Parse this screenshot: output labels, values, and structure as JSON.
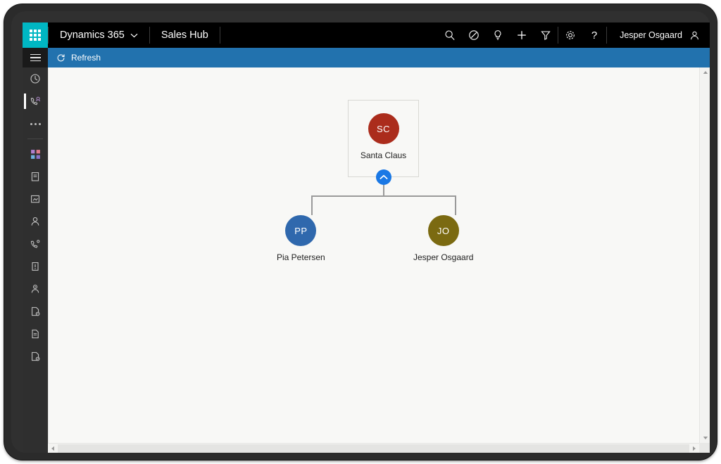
{
  "topbar": {
    "app_launcher_icon": "waffle-grid-icon",
    "brand": "Dynamics 365",
    "brand_chevron_icon": "chevron-down-icon",
    "app_name": "Sales Hub",
    "icons": [
      {
        "name": "search-icon",
        "glyph": "search"
      },
      {
        "name": "assistant-icon",
        "glyph": "assistant"
      },
      {
        "name": "insights-bulb-icon",
        "glyph": "bulb"
      },
      {
        "name": "quick-create-icon",
        "glyph": "plus"
      },
      {
        "name": "filter-icon",
        "glyph": "filter"
      },
      {
        "name": "settings-gear-icon",
        "glyph": "gear"
      },
      {
        "name": "help-icon",
        "glyph": "question"
      }
    ],
    "user_name": "Jesper Osgaard",
    "user_avatar_icon": "person-icon"
  },
  "commandbar": {
    "refresh_label": "Refresh",
    "refresh_icon": "refresh-icon",
    "accent_color": "#2272ae"
  },
  "sidebar": {
    "menu_icon": "hamburger-icon",
    "items": [
      {
        "name": "recent-icon",
        "glyph": "clock",
        "active": false
      },
      {
        "name": "pinned-icon",
        "glyph": "pin-contact",
        "active": true
      },
      {
        "name": "more-icon",
        "glyph": "dots",
        "active": false
      },
      {
        "name": "dashboards-icon",
        "glyph": "dashboard",
        "active": false
      },
      {
        "name": "activities-icon",
        "glyph": "clipboard",
        "active": false
      },
      {
        "name": "accounts-icon",
        "glyph": "building",
        "active": false
      },
      {
        "name": "contacts-icon",
        "glyph": "person",
        "active": false
      },
      {
        "name": "leads-icon",
        "glyph": "phone-contact",
        "active": false
      },
      {
        "name": "opportunities-icon",
        "glyph": "opportunity",
        "active": false
      },
      {
        "name": "competitors-icon",
        "glyph": "person-board",
        "active": false
      },
      {
        "name": "quotes-icon",
        "glyph": "doc-badge",
        "active": false
      },
      {
        "name": "orders-icon",
        "glyph": "doc",
        "active": false
      },
      {
        "name": "invoices-icon",
        "glyph": "doc-invoice",
        "active": false
      }
    ]
  },
  "chart_data": {
    "type": "org-chart",
    "title": "",
    "nodes": [
      {
        "id": "root",
        "initials": "SC",
        "label": "Santa Claus",
        "color": "#ab2c1c",
        "level": 0,
        "selected": true,
        "collapsible": true,
        "collapse_icon": "chevron-up-icon"
      },
      {
        "id": "child1",
        "initials": "PP",
        "label": "Pia Petersen",
        "color": "#2f68ad",
        "level": 1,
        "selected": false,
        "collapsible": false
      },
      {
        "id": "child2",
        "initials": "JO",
        "label": "Jesper Osgaard",
        "color": "#7b6a11",
        "level": 1,
        "selected": false,
        "collapsible": false
      }
    ],
    "edges": [
      {
        "from": "root",
        "to": "child1"
      },
      {
        "from": "root",
        "to": "child2"
      }
    ],
    "connector_color": "#9a9a9a",
    "background": "#f8f8f6"
  },
  "scrollbars": {
    "vertical_up_icon": "caret-up-icon",
    "vertical_down_icon": "caret-down-icon",
    "horizontal_left_icon": "caret-left-icon",
    "horizontal_right_icon": "caret-right-icon"
  }
}
